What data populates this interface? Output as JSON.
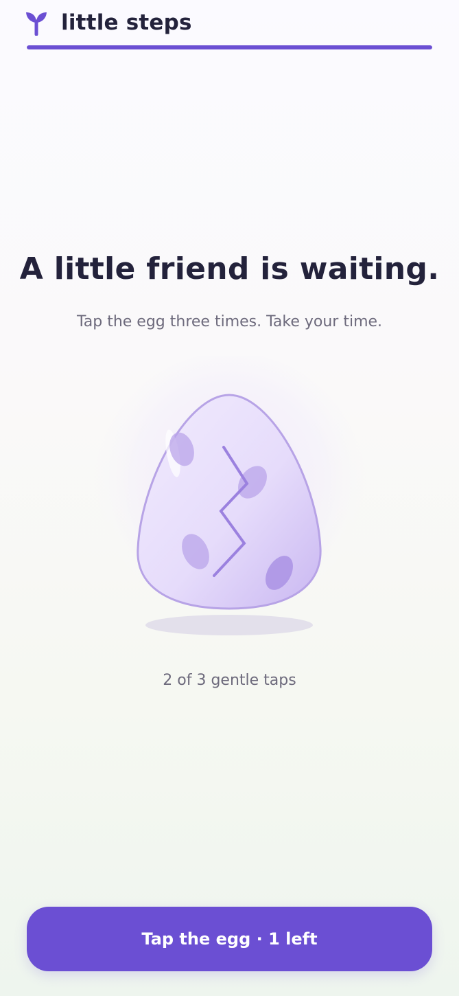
{
  "app": {
    "brand": "little steps",
    "brand_icon": "sprout-icon"
  },
  "progress": {
    "value": 1.0
  },
  "content": {
    "headline": "A little friend is waiting.",
    "subhead": "Tap the egg three times. Take your time.",
    "tap_status": "2 of 3 gentle taps"
  },
  "egg": {
    "icon": "egg-cracked-icon",
    "taps_done": 2,
    "taps_total": 3
  },
  "cta": {
    "label": "Tap the egg · 1 left"
  },
  "colors": {
    "accent": "#6b4fd3",
    "text_primary": "#23223b",
    "text_secondary": "#6d6a7c",
    "egg_fill": "#e6dcfb",
    "egg_stroke": "#b7a3e6"
  }
}
